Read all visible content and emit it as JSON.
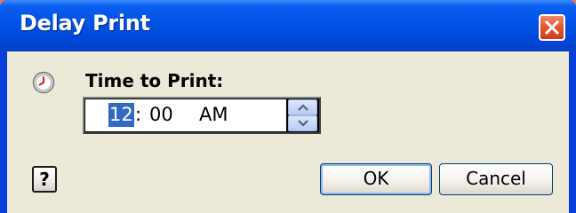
{
  "window": {
    "title": "Delay Print",
    "close_icon": "close-icon"
  },
  "form": {
    "clock_icon": "clock-icon",
    "label": "Time to Print:",
    "time": {
      "hour": "12",
      "separator": ":",
      "minutes": "00",
      "ampm": "AM"
    },
    "spinner": {
      "up_icon": "arrow-up-icon",
      "down_icon": "arrow-down-icon"
    }
  },
  "buttons": {
    "help_label": "?",
    "ok_label": "OK",
    "cancel_label": "Cancel"
  },
  "colors": {
    "titlebar": "#0054e3",
    "close": "#e0502c",
    "client": "#ece9d8",
    "selection": "#316ac5"
  }
}
